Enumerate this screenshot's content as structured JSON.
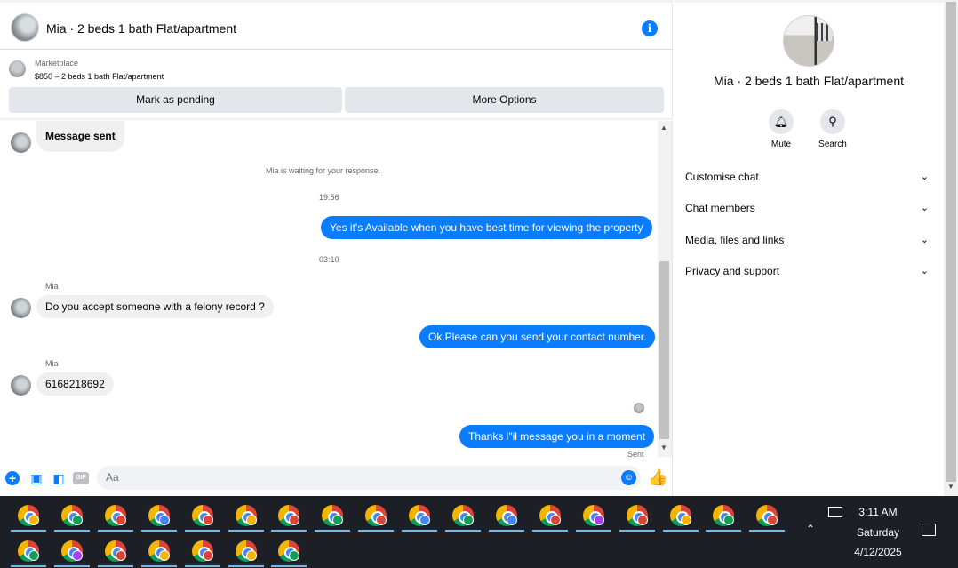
{
  "header": {
    "title": "Mia · 2 beds 1 bath Flat/apartment",
    "info_icon_glyph": "i"
  },
  "marketplace": {
    "label": "Marketplace",
    "listing": "$850 – 2 beds 1 bath Flat/apartment",
    "buttons": {
      "pending": "Mark as pending",
      "more": "More Options"
    }
  },
  "messages": {
    "first_in": "Message sent",
    "waiting": "Mia is waiting for your response.",
    "time1": "19:56",
    "out1": "Yes it's Available when you have best time for viewing the property",
    "time2": "03:10",
    "sender1": "Mia",
    "in2": "Do you accept someone with a felony record ?",
    "out2": "Ok.Please can you send your contact number.",
    "sender2": "Mia",
    "in3": "6168218692",
    "out3": "Thanks i\"il message you in a moment",
    "status": "Sent"
  },
  "composer": {
    "placeholder": "Aa",
    "gif_label": "GIF"
  },
  "info_panel": {
    "title": "Mia · 2 beds 1 bath Flat/apartment",
    "actions": {
      "mute": "Mute",
      "search": "Search"
    },
    "sections": [
      "Customise chat",
      "Chat members",
      "Media, files and links",
      "Privacy and support"
    ]
  },
  "taskbar": {
    "time": "3:11 AM",
    "day": "Saturday",
    "date": "4/12/2025",
    "profile_colors_row1": [
      "#f4b400",
      "#0f9d58",
      "#db4437",
      "#4285f4",
      "#db4437",
      "#f4b400",
      "#db4437",
      "#0f9d58",
      "#db4437",
      "#4285f4",
      "#0f9d58",
      "#4285f4",
      "#db4437",
      "#a142f4",
      "#db4437",
      "#f4b400",
      "#0f9d58",
      "#db4437"
    ],
    "profile_colors_row2": [
      "#0f9d58",
      "#a142f4",
      "#db4437",
      "#f4b400",
      "#db4437",
      "#f4b400",
      "#0f9d58"
    ]
  },
  "colors": {
    "accent": "#0a7cff",
    "bubble_in": "#f0f0f0",
    "taskbar": "#1c1f26"
  }
}
